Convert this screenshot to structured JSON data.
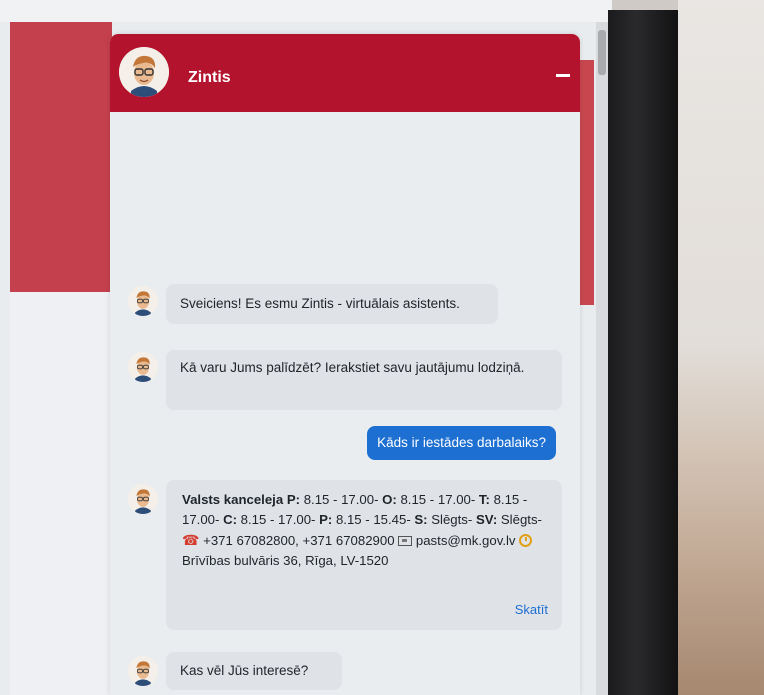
{
  "chat": {
    "assistant_name": "Zintis",
    "messages": [
      {
        "from": "bot",
        "text": "Sveiciens! Es esmu Zintis - virtuālais asistents."
      },
      {
        "from": "bot",
        "text": "Kā varu Jums palīdzēt? Ierakstiet savu jautājumu lodziņā."
      },
      {
        "from": "user",
        "text": "Kāds ir iestādes darbalaiks?"
      },
      {
        "from": "bot",
        "text": "Kas vēl Jūs interesē?"
      }
    ],
    "info_card": {
      "org": "Valsts kanceleja",
      "hours": [
        {
          "day": "P:",
          "time": " 8.15 - 17.00- "
        },
        {
          "day": "O:",
          "time": " 8.15 - 17.00- "
        },
        {
          "day": "T:",
          "time": " 8.15 - 17.00- "
        },
        {
          "day": "C:",
          "time": " 8.15 - 17.00- "
        },
        {
          "day": "P:",
          "time": " 8.15 - 15.45- "
        },
        {
          "day": "S:",
          "time": " Slēgts- "
        },
        {
          "day": "SV:",
          "time": " Slēgts- "
        }
      ],
      "phones": "+371 67082800, +371 67082900",
      "email": "pasts@mk.gov.lv",
      "address": "Brīvības bulvāris 36, Rīga, LV-1520",
      "link_label": "Skatīt"
    }
  },
  "colors": {
    "header": "#b3132d",
    "user_bubble": "#1d6fd1",
    "bot_bubble": "#dfe2e7",
    "phone_icon": "#d63b2f",
    "clock_icon": "#e0a116"
  },
  "icons": {
    "phone": "phone-icon",
    "email": "mail-icon",
    "address": "clock-icon",
    "minimize": "minimize-icon"
  }
}
